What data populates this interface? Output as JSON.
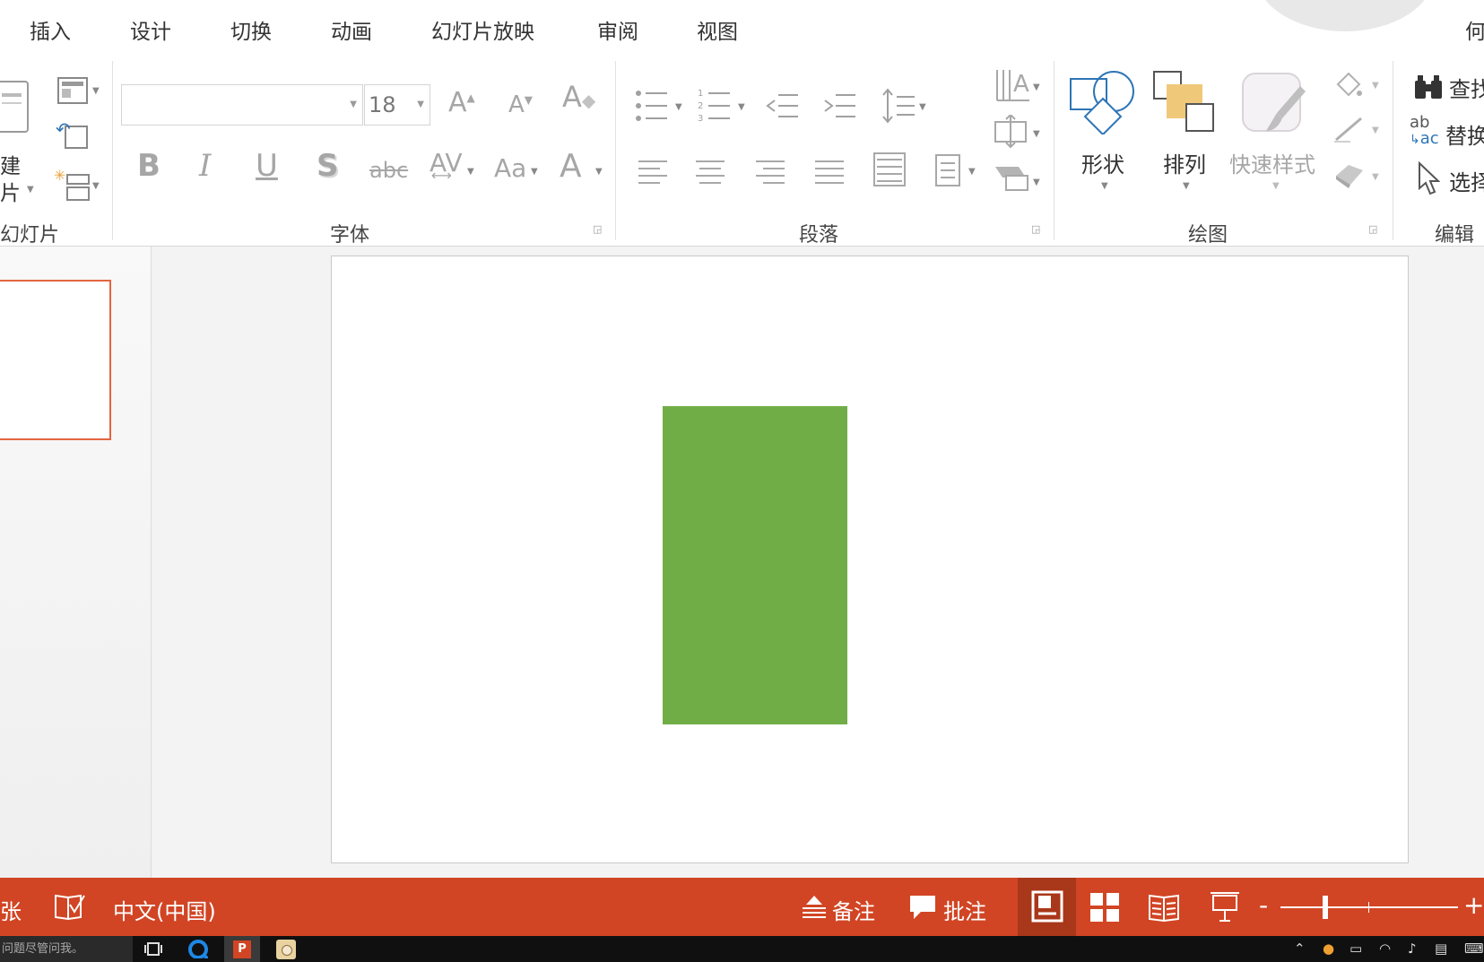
{
  "ribbon_tabs": [
    "插入",
    "设计",
    "切换",
    "动画",
    "幻灯片放映",
    "审阅",
    "视图"
  ],
  "ribbon_tabs_cut": "何",
  "groups": {
    "slides": {
      "label": "幻灯片",
      "new_slide_line1": "建",
      "new_slide_line2": "片"
    },
    "font": {
      "label": "字体",
      "font_name": "",
      "font_size": "18",
      "bold": "B",
      "italic": "I",
      "underline": "U",
      "shadow": "S",
      "strike": "abc",
      "spacing": "AV",
      "case": "Aa",
      "color": "A",
      "grow": "A",
      "shrink": "A"
    },
    "paragraph": {
      "label": "段落"
    },
    "drawing": {
      "label": "绘图",
      "shapes": "形状",
      "arrange": "排列",
      "quick_styles": "快速样式"
    },
    "editing": {
      "label": "编辑",
      "find": "查找",
      "replace": "替换",
      "select": "选择",
      "replace_icon_text_1": "ab",
      "replace_icon_text_2": "ac"
    }
  },
  "slide": {
    "shape_color": "#70ad47"
  },
  "statusbar": {
    "slide_count_cut": "张",
    "language": "中文(中国)",
    "notes": "备注",
    "comments": "批注",
    "minus": "-",
    "plus": "+",
    "zoom_level": 0.25
  },
  "taskbar": {
    "search_placeholder": "问题尽管问我。"
  },
  "colors": {
    "accent": "#d14524",
    "accent_dark": "#a93719",
    "selection_border": "#e5643f"
  }
}
